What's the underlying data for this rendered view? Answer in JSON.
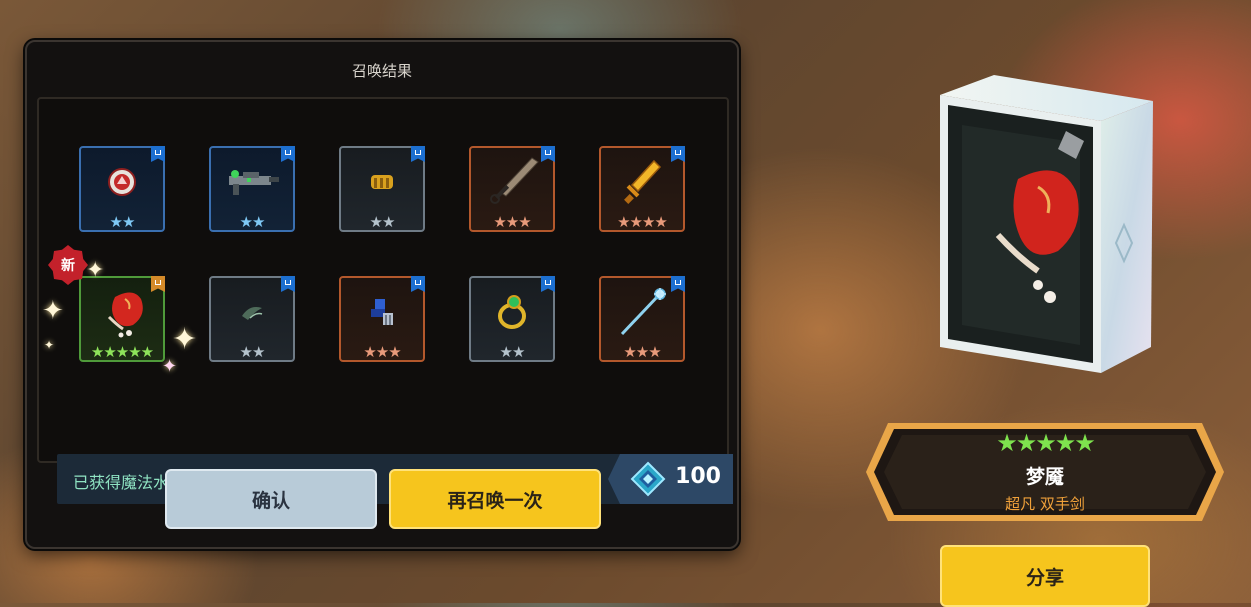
{
  "panel": {
    "title": "召唤结果",
    "new_badge": "新",
    "crystal_label": "已获得魔法水晶",
    "crystal_amount": "100"
  },
  "items": [
    {
      "name": "shield-icon",
      "rarity": "blue",
      "stars": "★★",
      "stars_color": "blue"
    },
    {
      "name": "rifle-icon",
      "rarity": "blue",
      "stars": "★★",
      "stars_color": "blue"
    },
    {
      "name": "gauntlet-icon",
      "rarity": "gray",
      "stars": "★★",
      "stars_color": "gray"
    },
    {
      "name": "sword-icon",
      "rarity": "orange",
      "stars": "★★★",
      "stars_color": "orange"
    },
    {
      "name": "golden-dagger-icon",
      "rarity": "orange",
      "stars": "★★★★",
      "stars_color": "orange"
    },
    {
      "name": "red-pouch-icon",
      "rarity": "green",
      "stars": "★★★★★",
      "stars_color": "green"
    },
    {
      "name": "leaf-blade-icon",
      "rarity": "gray",
      "stars": "★★",
      "stars_color": "gray"
    },
    {
      "name": "blue-figure-icon",
      "rarity": "orange",
      "stars": "★★★",
      "stars_color": "orange"
    },
    {
      "name": "emerald-ring-icon",
      "rarity": "gray",
      "stars": "★★",
      "stars_color": "gray"
    },
    {
      "name": "ice-staff-icon",
      "rarity": "orange",
      "stars": "★★★",
      "stars_color": "orange"
    }
  ],
  "buttons": {
    "confirm": "确认",
    "summon_again": "再召唤一次",
    "share": "分享"
  },
  "featured": {
    "stars": "★★★★★",
    "name": "梦魇",
    "type": "超凡  双手剑"
  },
  "colors": {
    "accent_yellow": "#f6c51d",
    "rarity_blue": "#3a6fb0",
    "rarity_orange": "#b3582c",
    "rarity_green": "#4f9a3a",
    "rarity_gray": "#6f7b86",
    "crystal_text": "#8fe3c2"
  }
}
